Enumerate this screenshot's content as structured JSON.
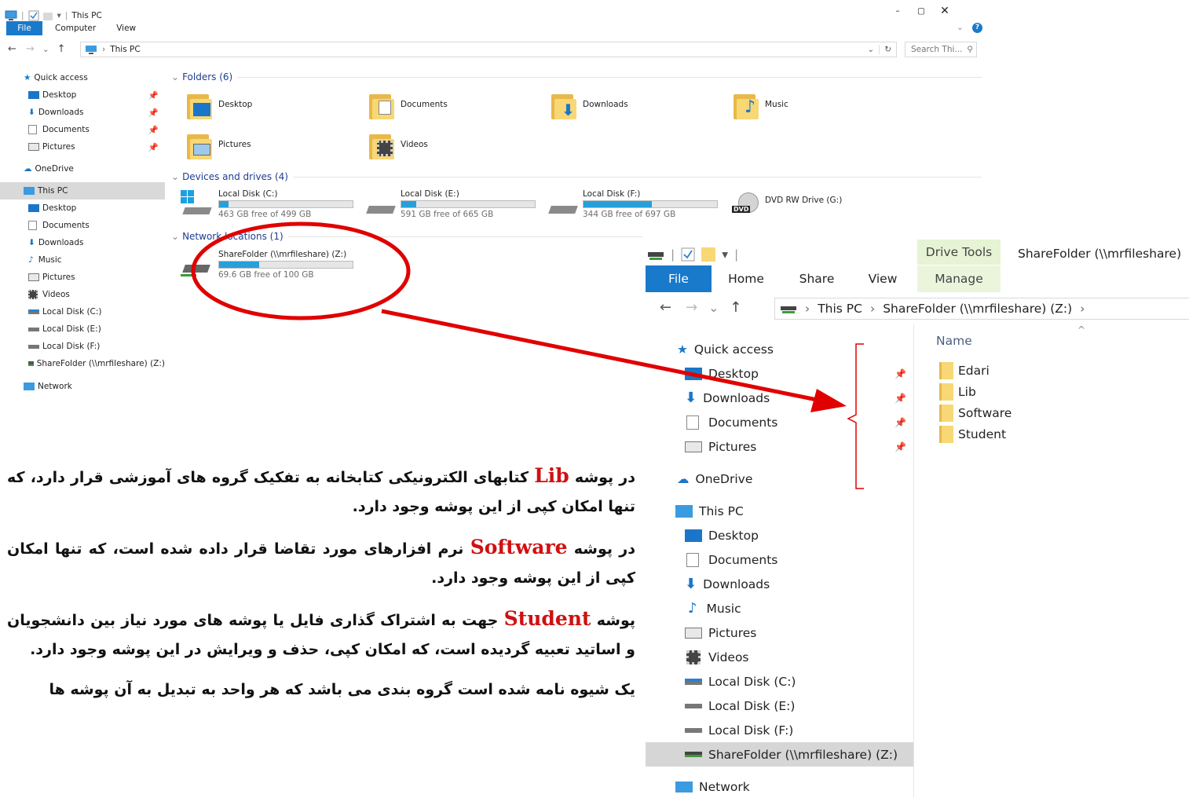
{
  "window1": {
    "title": "This PC",
    "menu": [
      "File",
      "Computer",
      "View"
    ],
    "address": {
      "crumb": "This PC"
    },
    "search_placeholder": "Search Thi...",
    "nav": {
      "quick_access": "Quick access",
      "quick_items": [
        "Desktop",
        "Downloads",
        "Documents",
        "Pictures"
      ],
      "onedrive": "OneDrive",
      "this_pc": "This PC",
      "pc_items": [
        "Desktop",
        "Documents",
        "Downloads",
        "Music",
        "Pictures",
        "Videos",
        "Local Disk (C:)",
        "Local Disk (E:)",
        "Local Disk (F:)",
        "ShareFolder (\\\\mrfileshare) (Z:)"
      ],
      "network": "Network"
    },
    "folders_header": "Folders (6)",
    "folders": [
      "Desktop",
      "Documents",
      "Downloads",
      "Music",
      "Pictures",
      "Videos"
    ],
    "drives_header": "Devices and drives (4)",
    "drives": [
      {
        "name": "Local Disk (C:)",
        "free": "463 GB free of 499 GB",
        "used_fraction": 0.07
      },
      {
        "name": "Local Disk (E:)",
        "free": "591 GB free of 665 GB",
        "used_fraction": 0.11
      },
      {
        "name": "Local Disk (F:)",
        "free": "344 GB free of 697 GB",
        "used_fraction": 0.51
      }
    ],
    "dvd": "DVD RW Drive (G:)",
    "dvd_badge": "DVD",
    "network_header": "Network locations (1)",
    "network_location": {
      "name": "ShareFolder (\\\\mrfileshare) (Z:)",
      "free": "69.6 GB free of 100 GB",
      "used_fraction": 0.3
    }
  },
  "window2": {
    "tabs": {
      "file": "File",
      "home": "Home",
      "share": "Share",
      "view": "View",
      "drive_tools": "Drive Tools",
      "manage": "Manage"
    },
    "title": "ShareFolder (\\\\mrfileshare)",
    "breadcrumb": [
      "This PC",
      "ShareFolder (\\\\mrfileshare) (Z:)"
    ],
    "column_name": "Name",
    "files": [
      "Edari",
      "Lib",
      "Software",
      "Student"
    ],
    "nav": {
      "quick_access": "Quick access",
      "quick_items": [
        "Desktop",
        "Downloads",
        "Documents",
        "Pictures"
      ],
      "onedrive": "OneDrive",
      "this_pc": "This PC",
      "pc_items": [
        "Desktop",
        "Documents",
        "Downloads",
        "Music",
        "Pictures",
        "Videos",
        "Local Disk (C:)",
        "Local Disk (E:)",
        "Local Disk (F:)",
        "ShareFolder (\\\\mrfileshare) (Z:)"
      ],
      "network": "Network"
    }
  },
  "annotation": {
    "p1": {
      "pre": "در پوشه",
      "kw": "Lib",
      "post": "کتابهای الکترونیکی کتابخانه به تفکیک گروه های آموزشی قرار دارد، که تنها امکان کپی از این پوشه وجود دارد."
    },
    "p2": {
      "pre": "در پوشه",
      "kw": "Software",
      "post": "نرم افزارهای مورد تقاضا قرار داده شده است، که تنها امکان کپی از این پوشه وجود دارد."
    },
    "p3": {
      "pre": "پوشه",
      "kw": "Student",
      "post": "جهت به اشتراک گذاری فایل یا پوشه های مورد نیاز بین دانشجویان و اساتید تعبیه گردیده است، که امکان کپی، حذف و ویرایش در این پوشه وجود دارد."
    },
    "p4": "یک شیوه نامه شده است گروه بندی می باشد که هر واحد به تبدیل به آن پوشه ها"
  },
  "colors": {
    "accent": "#1979ca",
    "annotation_red": "#e00000",
    "keyword_red": "#d01010",
    "drive_fill": "#26a0da"
  }
}
